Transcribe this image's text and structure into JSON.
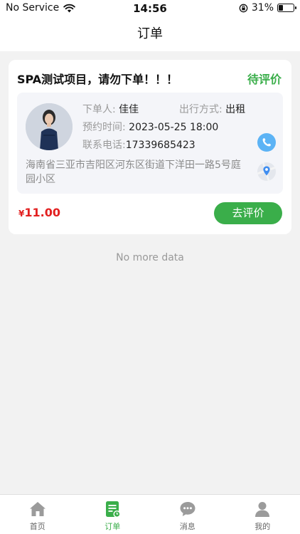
{
  "status_bar": {
    "carrier": "No Service",
    "time": "14:56",
    "battery": "31%",
    "battery_level": 0.31
  },
  "header": {
    "title": "订单"
  },
  "order": {
    "title": "SPA测试项目，请勿下单！！！",
    "status": "待评价",
    "customer_label": "下单人:",
    "customer_value": "佳佳",
    "travel_label": "出行方式:",
    "travel_value": "出租",
    "appointment_label": "预约时间:",
    "appointment_value": "2023-05-25 18:00",
    "phone_label": "联系电话:",
    "phone_value": "17339685423",
    "address": "海南省三亚市吉阳区河东区街道下洋田一路5号庭园小区",
    "currency": "¥",
    "price": "11.00",
    "review_button": "去评价"
  },
  "footer_note": "No more data",
  "tab_bar": {
    "items": [
      {
        "label": "首页",
        "icon": "home-icon"
      },
      {
        "label": "订单",
        "icon": "orders-icon",
        "active": true
      },
      {
        "label": "消息",
        "icon": "message-icon"
      },
      {
        "label": "我的",
        "icon": "profile-icon"
      }
    ]
  },
  "colors": {
    "accent": "#3aae4a",
    "price": "#e22020",
    "phone": "#5cb3f5"
  }
}
